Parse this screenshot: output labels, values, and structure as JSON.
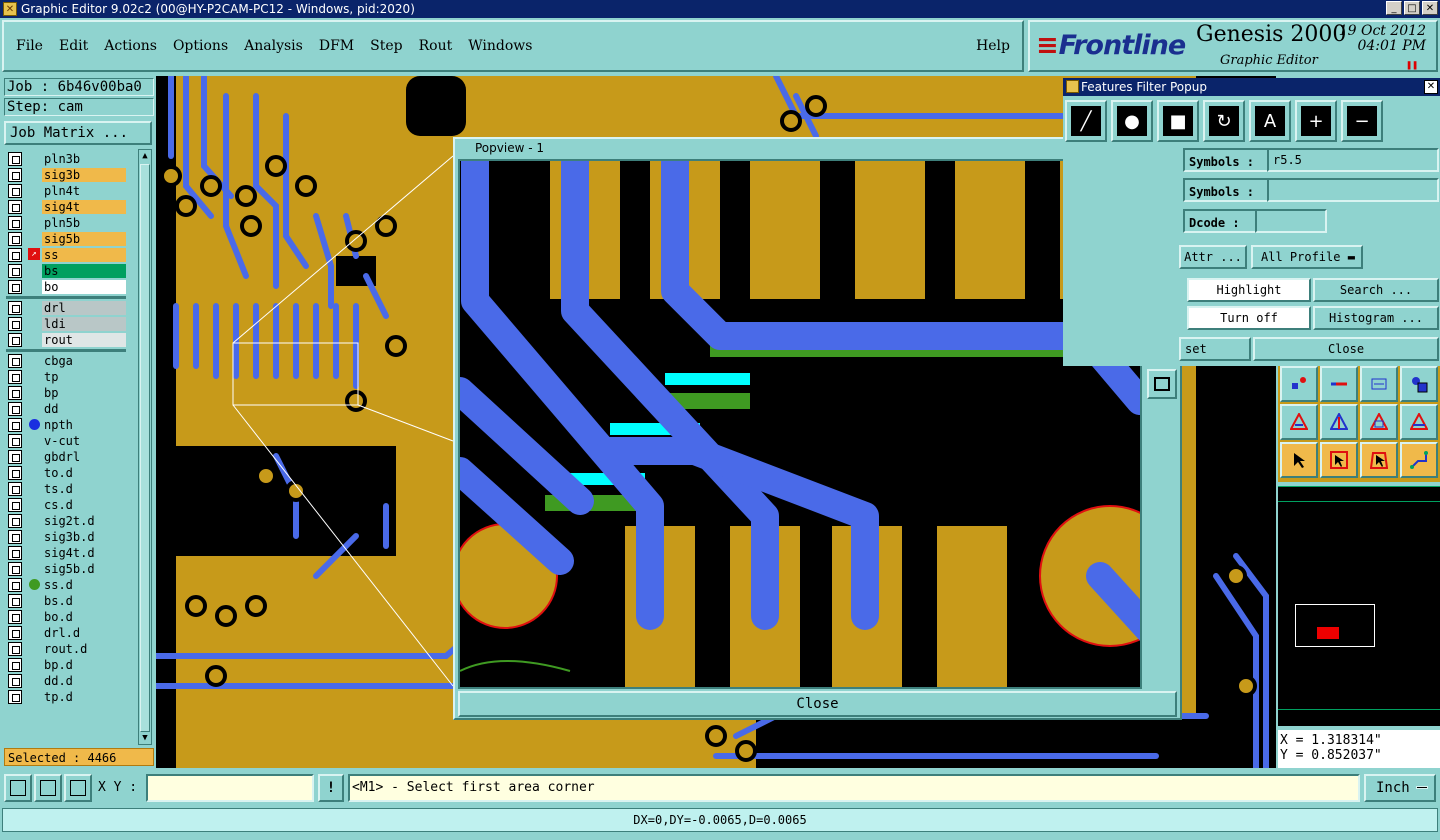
{
  "window": {
    "title": "Graphic Editor 9.02c2 (00@HY-P2CAM-PC12 - Windows, pid:2020)"
  },
  "menu": {
    "items": [
      "File",
      "Edit",
      "Actions",
      "Options",
      "Analysis",
      "DFM",
      "Step",
      "Rout",
      "Windows"
    ],
    "help": "Help"
  },
  "brand": {
    "logo": "Frontline",
    "product": "Genesis 2000",
    "subtitle": "Graphic Editor",
    "date": "19 Oct 2012",
    "time": "04:01 PM"
  },
  "left": {
    "job": "Job : 6b46v00ba0",
    "step": "Step: cam",
    "job_matrix": "Job Matrix ...",
    "layers": [
      {
        "name": "pln3b",
        "color": "#8fd3cf"
      },
      {
        "name": "sig3b",
        "color": "#f0b94a"
      },
      {
        "name": "pln4t",
        "color": "#8fd3cf"
      },
      {
        "name": "sig4t",
        "color": "#f0b94a"
      },
      {
        "name": "pln5b",
        "color": "#8fd3cf"
      },
      {
        "name": "sig5b",
        "color": "#f0b94a"
      },
      {
        "name": "ss",
        "color": "#f0b94a"
      },
      {
        "name": "bs",
        "color": "#00a060"
      },
      {
        "name": "bo",
        "color": "#ffffff"
      },
      {
        "name": "drl",
        "color": "#b9c7c7"
      },
      {
        "name": "ldi",
        "color": "#b9c7c7"
      },
      {
        "name": "rout",
        "color": "#dfe6e6"
      },
      {
        "name": "cbga",
        "color": "#8fd3cf"
      },
      {
        "name": "tp",
        "color": "#8fd3cf"
      },
      {
        "name": "bp",
        "color": "#8fd3cf"
      },
      {
        "name": "dd",
        "color": "#8fd3cf"
      },
      {
        "name": "npth",
        "color": "#8fd3cf"
      },
      {
        "name": "v-cut",
        "color": "#8fd3cf"
      },
      {
        "name": "gbdrl",
        "color": "#8fd3cf"
      },
      {
        "name": "to.d",
        "color": "#8fd3cf"
      },
      {
        "name": "ts.d",
        "color": "#8fd3cf"
      },
      {
        "name": "cs.d",
        "color": "#8fd3cf"
      },
      {
        "name": "sig2t.d",
        "color": "#8fd3cf"
      },
      {
        "name": "sig3b.d",
        "color": "#8fd3cf"
      },
      {
        "name": "sig4t.d",
        "color": "#8fd3cf"
      },
      {
        "name": "sig5b.d",
        "color": "#8fd3cf"
      },
      {
        "name": "ss.d",
        "color": "#8fd3cf"
      },
      {
        "name": "bs.d",
        "color": "#8fd3cf"
      },
      {
        "name": "bo.d",
        "color": "#8fd3cf"
      },
      {
        "name": "drl.d",
        "color": "#8fd3cf"
      },
      {
        "name": "rout.d",
        "color": "#8fd3cf"
      },
      {
        "name": "bp.d",
        "color": "#8fd3cf"
      },
      {
        "name": "dd.d",
        "color": "#8fd3cf"
      },
      {
        "name": "tp.d",
        "color": "#8fd3cf"
      }
    ],
    "selected": "Selected : 4466"
  },
  "popview": {
    "title": "Popview - 1",
    "close": "Close"
  },
  "filter": {
    "title": "Features Filter Popup",
    "symbols_label": "Symbols :",
    "symbols_value": "r5.5",
    "symbols2_label": "Symbols :",
    "symbols2_value": "",
    "dcode_label": "Dcode :",
    "dcode_value": "",
    "attr": "Attr ...",
    "profile": "All Profile",
    "highlight": "Highlight",
    "search": "Search ...",
    "turnoff": "Turn off",
    "histogram": "Histogram ...",
    "reset": "set",
    "close": "Close"
  },
  "coords": {
    "x": "X = 1.318314\"",
    "y": "Y = 0.852037\""
  },
  "bottom": {
    "xy_label": "X Y :",
    "xy_value": "",
    "bang": "!",
    "prompt": "<M1> - Select first area corner",
    "units": "Inch",
    "status": "DX=0,DY=-0.0065,D=0.0065"
  },
  "colors": {
    "board": "#c79a1a",
    "trace": "#4a6ae8",
    "panel": "#8fd3cf",
    "highlight": "#00ffff",
    "green": "#3f9a22"
  }
}
